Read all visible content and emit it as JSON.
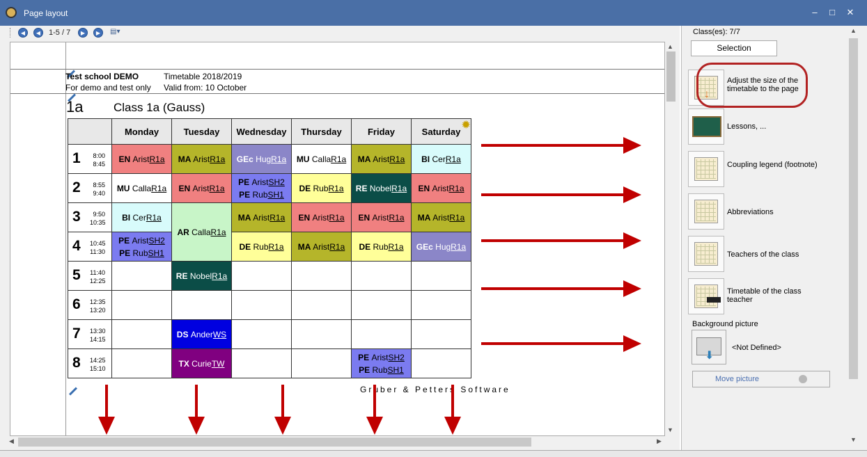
{
  "window": {
    "title": "Page layout",
    "min": "–",
    "max": "□",
    "close": "✕"
  },
  "toolbar": {
    "page_info": "1-5 / 7",
    "nav_icons": [
      "first-page-icon",
      "prev-page-icon",
      "next-page-icon",
      "last-page-icon"
    ]
  },
  "page": {
    "school": "Test school  DEMO",
    "subtitle": "For demo and test only",
    "timetable_year": "Timetable 2018/2019",
    "valid_from": "Valid from: 10 October",
    "class_code": "1a",
    "class_title": "Class 1a (Gauss)",
    "footer": "Gruber & Petters Software"
  },
  "timetable": {
    "days": [
      "Monday",
      "Tuesday",
      "Wednesday",
      "Thursday",
      "Friday",
      "Saturday"
    ],
    "periods": [
      {
        "num": "1",
        "start": "8:00",
        "end": "8:45"
      },
      {
        "num": "2",
        "start": "8:55",
        "end": "9:40"
      },
      {
        "num": "3",
        "start": "9:50",
        "end": "10:35"
      },
      {
        "num": "4",
        "start": "10:45",
        "end": "11:30"
      },
      {
        "num": "5",
        "start": "11:40",
        "end": "12:25"
      },
      {
        "num": "6",
        "start": "12:35",
        "end": "13:20"
      },
      {
        "num": "7",
        "start": "13:30",
        "end": "14:15"
      },
      {
        "num": "8",
        "start": "14:25",
        "end": "15:10"
      }
    ],
    "cells": {
      "p1": [
        {
          "subj": "EN",
          "teacher": "Arist",
          "room": "R1a",
          "bg": "#f08080",
          "fg": "#000"
        },
        {
          "subj": "MA",
          "teacher": "Arist",
          "room": "R1a",
          "bg": "#b5b52a",
          "fg": "#000"
        },
        {
          "subj": "GEc",
          "teacher": "Hug",
          "room": "R1a",
          "bg": "#8b86c8",
          "fg": "#fff"
        },
        {
          "subj": "MU",
          "teacher": "Calla",
          "room": "R1a",
          "bg": "#ffffff",
          "fg": "#000"
        },
        {
          "subj": "MA",
          "teacher": "Arist",
          "room": "R1a",
          "bg": "#b5b52a",
          "fg": "#000"
        },
        {
          "subj": "BI",
          "teacher": "Cer",
          "room": "R1a",
          "bg": "#d8fbfb",
          "fg": "#000"
        }
      ],
      "p2": [
        {
          "subj": "MU",
          "teacher": "Calla",
          "room": "R1a",
          "bg": "#ffffff",
          "fg": "#000"
        },
        {
          "subj": "EN",
          "teacher": "Arist",
          "room": "R1a",
          "bg": "#f08080",
          "fg": "#000"
        },
        {
          "subj": "PE",
          "teacher": "Arist",
          "room": "SH2",
          "subj2": "PE",
          "teacher2": "Rub",
          "room2": "SH1",
          "bg": "#7b7bf0",
          "fg": "#000"
        },
        {
          "subj": "DE",
          "teacher": "Rub",
          "room": "R1a",
          "bg": "#ffff99",
          "fg": "#000"
        },
        {
          "subj": "RE",
          "teacher": "Nobel",
          "room": "R1a",
          "bg": "#0b4d47",
          "fg": "#fff"
        },
        {
          "subj": "EN",
          "teacher": "Arist",
          "room": "R1a",
          "bg": "#f08080",
          "fg": "#000"
        }
      ],
      "p3": [
        {
          "subj": "BI",
          "teacher": "Cer",
          "room": "R1a",
          "bg": "#d8fbfb",
          "fg": "#000"
        },
        {
          "subj": "AR",
          "teacher": "Calla",
          "room": "R1a",
          "bg": "#c8f5c8",
          "fg": "#000"
        },
        {
          "subj": "MA",
          "teacher": "Arist",
          "room": "R1a",
          "bg": "#b5b52a",
          "fg": "#000"
        },
        {
          "subj": "EN",
          "teacher": "Arist",
          "room": "R1a",
          "bg": "#f08080",
          "fg": "#000"
        },
        {
          "subj": "EN",
          "teacher": "Arist",
          "room": "R1a",
          "bg": "#f08080",
          "fg": "#000"
        },
        {
          "subj": "MA",
          "teacher": "Arist",
          "room": "R1a",
          "bg": "#b5b52a",
          "fg": "#000"
        }
      ],
      "p4": [
        {
          "subj": "PE",
          "teacher": "Arist",
          "room": "SH2",
          "subj2": "PE",
          "teacher2": "Rub",
          "room2": "SH1",
          "bg": "#7b7bf0",
          "fg": "#000"
        },
        {
          "subj": "DE",
          "teacher": "Rub",
          "room": "R1a",
          "bg": "#ffff99",
          "fg": "#000"
        },
        {
          "subj": "MA",
          "teacher": "Arist",
          "room": "R1a",
          "bg": "#b5b52a",
          "fg": "#000"
        },
        {
          "subj": "DE",
          "teacher": "Rub",
          "room": "R1a",
          "bg": "#ffff99",
          "fg": "#000"
        },
        {
          "subj": "GEc",
          "teacher": "Hug",
          "room": "R1a",
          "bg": "#8b86c8",
          "fg": "#fff"
        }
      ],
      "p5": {
        "subj": "RE",
        "teacher": "Nobel",
        "room": "R1a",
        "bg": "#0b4d47",
        "fg": "#fff"
      },
      "p7": {
        "subj": "DS",
        "teacher": "Ander",
        "room": "WS",
        "bg": "#0000e0",
        "fg": "#fff"
      },
      "p8a": {
        "subj": "TX",
        "teacher": "Curie",
        "room": "TW",
        "bg": "#800080",
        "fg": "#fff"
      },
      "p8b": {
        "subj": "PE",
        "teacher": "Arist",
        "room": "SH2",
        "subj2": "PE",
        "teacher2": "Rub",
        "room2": "SH1",
        "bg": "#7b7bf0",
        "fg": "#000"
      }
    }
  },
  "sidebar": {
    "classes_label": "Class(es): 7/7",
    "selection_button": "Selection",
    "items": [
      {
        "label": "Adjust the size of the timetable to the page",
        "icon": "adjust-size-icon"
      },
      {
        "label": "Lessons, ...",
        "icon": "lessons-icon"
      },
      {
        "label": "Coupling legend (footnote)",
        "icon": "coupling-legend-icon"
      },
      {
        "label": "Abbreviations",
        "icon": "abbreviations-icon"
      },
      {
        "label": "Teachers of the class",
        "icon": "teachers-icon"
      },
      {
        "label": "Timetable of the class teacher",
        "icon": "class-teacher-icon"
      }
    ],
    "background_label": "Background picture",
    "background_value": "<Not Defined>",
    "move_picture": "Move picture"
  },
  "colors": {
    "titlebar": "#4a6fa6",
    "annotation": "#c00000"
  }
}
